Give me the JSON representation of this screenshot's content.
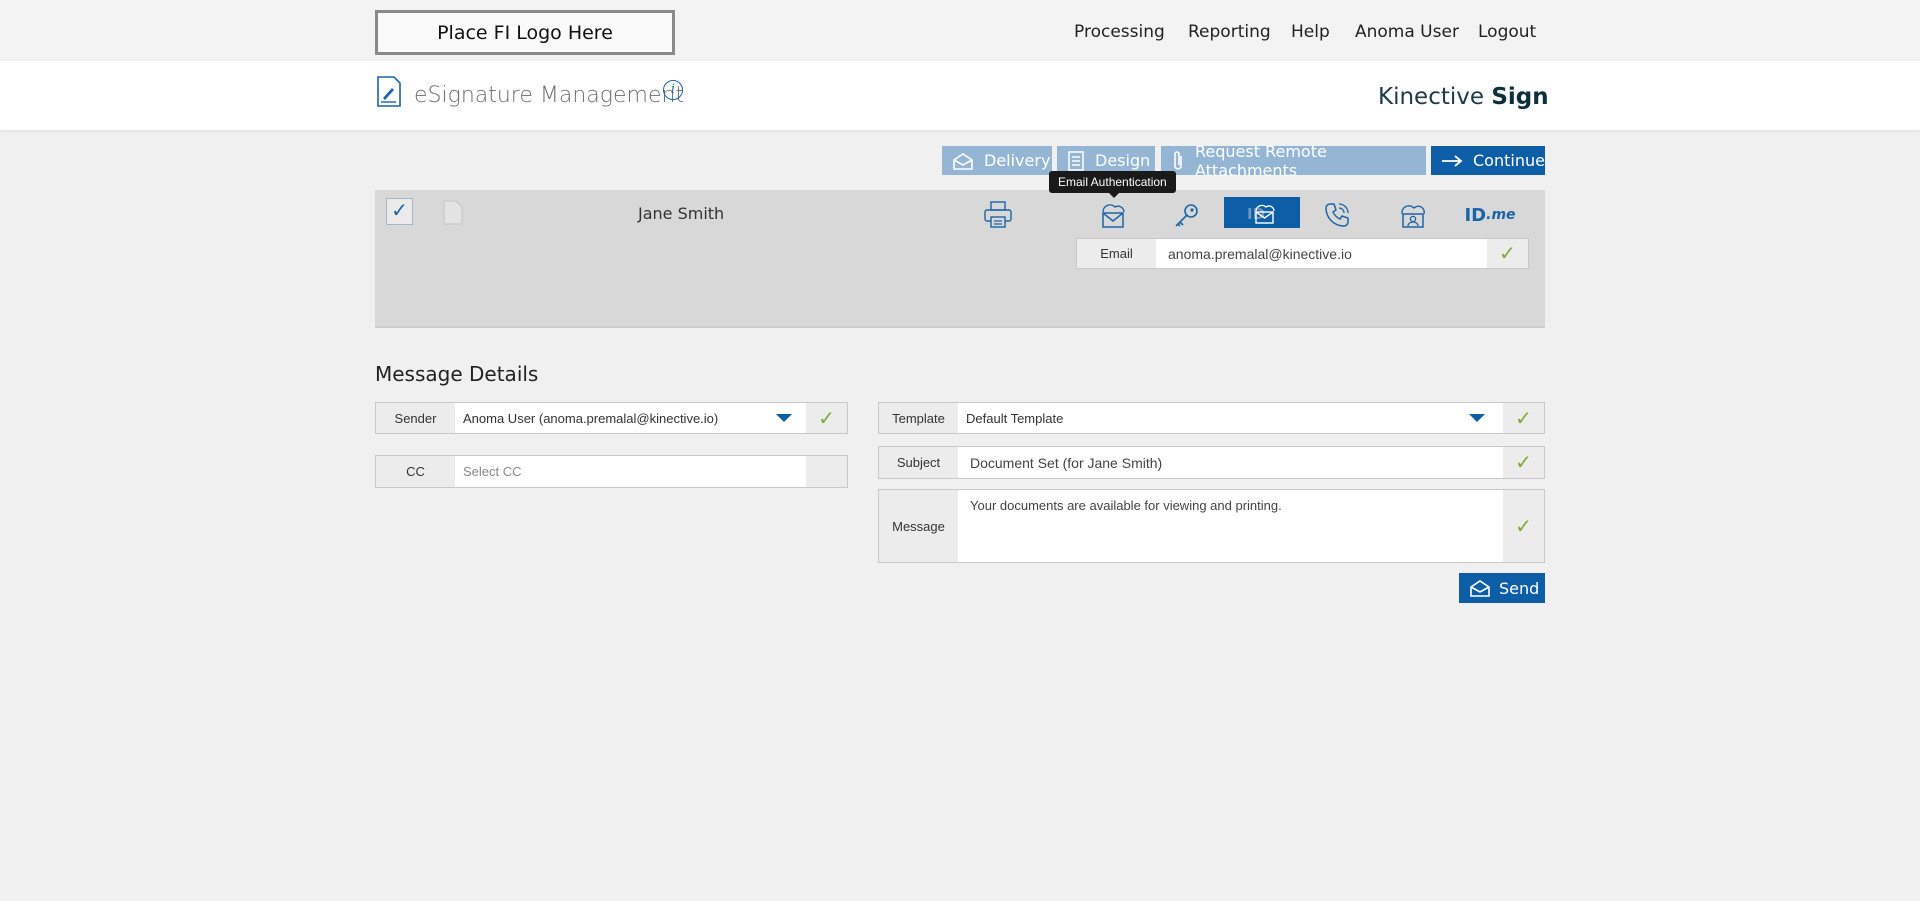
{
  "header": {
    "logo_text": "Place FI Logo Here",
    "nav": [
      "Processing",
      "Reporting",
      "Help",
      "Anoma User",
      "Logout"
    ]
  },
  "titlebar": {
    "title": "eSignature Management",
    "info_glyph": "i",
    "brand_light": "Kinective",
    "brand_bold": "Sign"
  },
  "toolbar": {
    "delivery": "Delivery",
    "design": "Design",
    "attachments": "Request Remote Attachments",
    "continue": "Continue"
  },
  "signer": {
    "name": "Jane Smith",
    "checked_glyph": "✓",
    "tooltip": "Email Authentication",
    "auth_icons": [
      "print-icon",
      "email-auth-icon",
      "key-icon",
      "idme-email-icon",
      "phone-icon",
      "cloud-person-icon",
      "idme-logo"
    ],
    "idme_text": "ID",
    "idme_suffix": ".me",
    "email_label": "Email",
    "email_value": "anoma.premalal@kinective.io"
  },
  "message": {
    "section_title": "Message Details",
    "sender_label": "Sender",
    "sender_value": "Anoma User (anoma.premalal@kinective.io)",
    "cc_label": "CC",
    "cc_placeholder": "Select CC",
    "template_label": "Template",
    "template_value": "Default Template",
    "subject_label": "Subject",
    "subject_value": "Document Set (for Jane Smith)",
    "message_label": "Message",
    "message_value": "Your documents are available for viewing and printing.",
    "send_label": "Send",
    "ok_glyph": "✓"
  },
  "colors": {
    "primary": "#0d5ea7",
    "toolbar_muted": "#94b5d4",
    "check_green": "#7aab3b"
  }
}
